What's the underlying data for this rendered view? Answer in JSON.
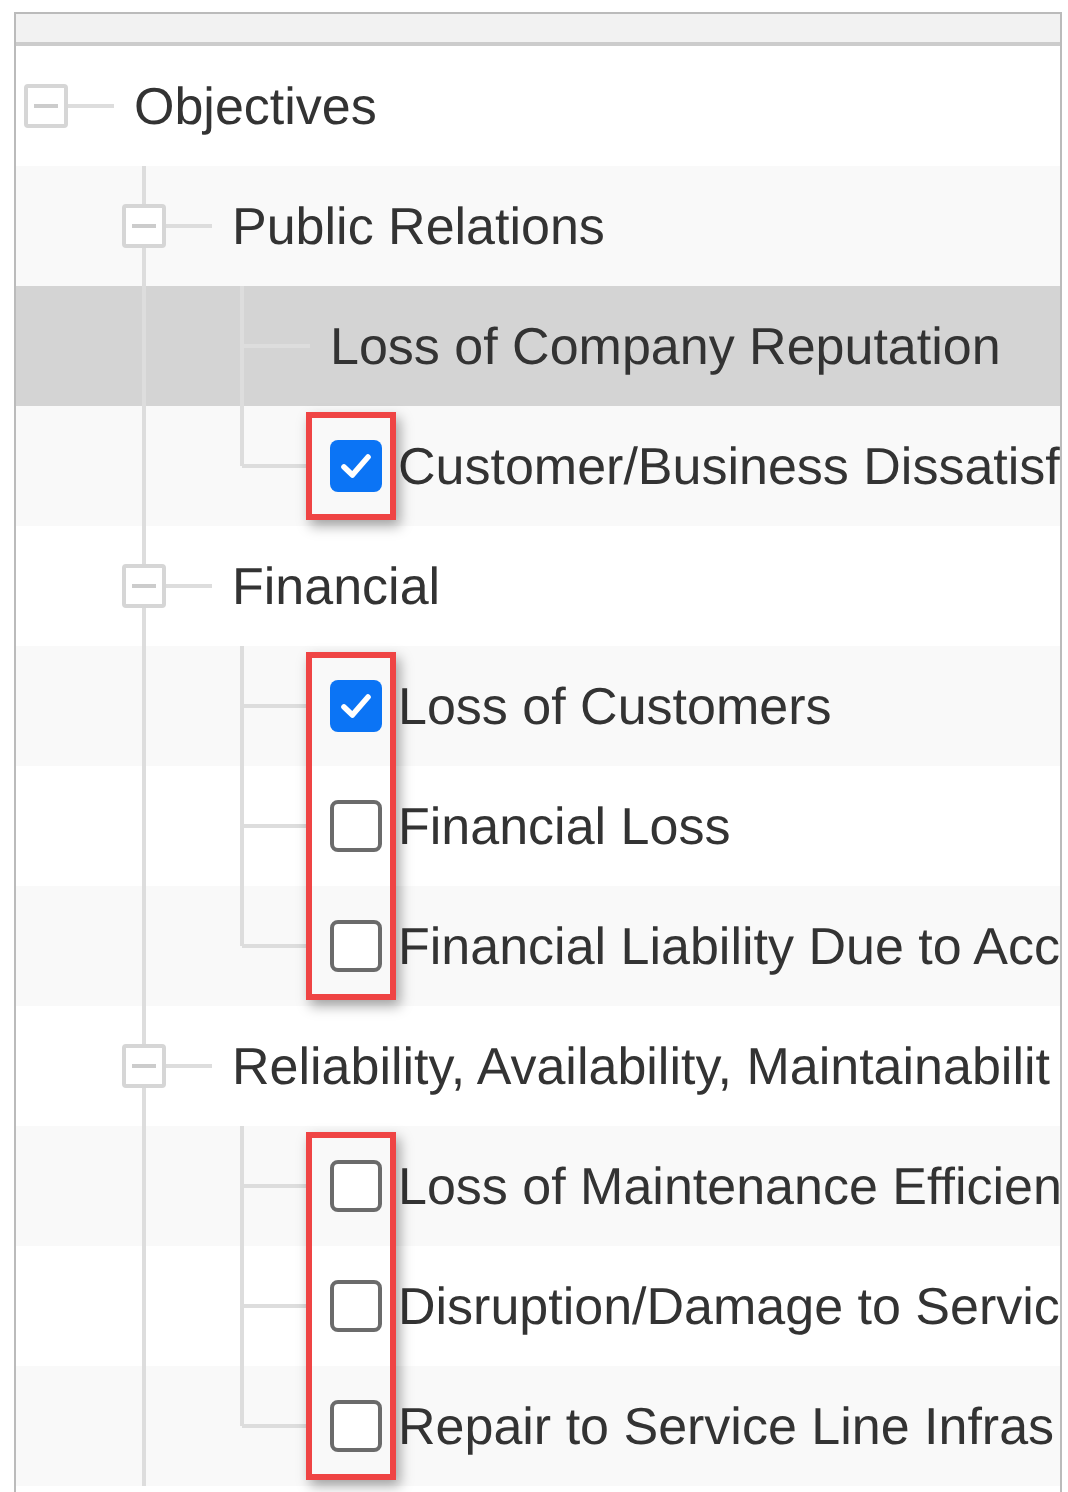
{
  "tree": [
    {
      "label": "Objectives",
      "kind": "group",
      "expanded": true,
      "selected": false,
      "children": [
        {
          "label": "Public Relations",
          "kind": "group",
          "expanded": true,
          "selected": false,
          "highlighted": true,
          "children": [
            {
              "label": "Loss of Company Reputation",
              "kind": "plain",
              "selected": true
            },
            {
              "label": "Customer/Business Dissatisf",
              "kind": "checkbox",
              "checked": true,
              "selected": false
            }
          ]
        },
        {
          "label": "Financial",
          "kind": "group",
          "expanded": true,
          "selected": false,
          "highlighted": true,
          "children": [
            {
              "label": "Loss of Customers",
              "kind": "checkbox",
              "checked": true,
              "selected": false
            },
            {
              "label": "Financial Loss",
              "kind": "checkbox",
              "checked": false,
              "selected": false
            },
            {
              "label": "Financial Liability Due to Acc",
              "kind": "checkbox",
              "checked": false,
              "selected": false
            }
          ]
        },
        {
          "label": "Reliability, Availability, Maintainabilit",
          "kind": "group",
          "expanded": true,
          "selected": false,
          "highlighted": true,
          "children": [
            {
              "label": "Loss of Maintenance Efficien",
              "kind": "checkbox",
              "checked": false,
              "selected": false
            },
            {
              "label": "Disruption/Damage to Servic",
              "kind": "checkbox",
              "checked": false,
              "selected": false
            },
            {
              "label": "Repair to Service Line Infras",
              "kind": "checkbox",
              "checked": false,
              "selected": false
            }
          ]
        }
      ]
    }
  ]
}
